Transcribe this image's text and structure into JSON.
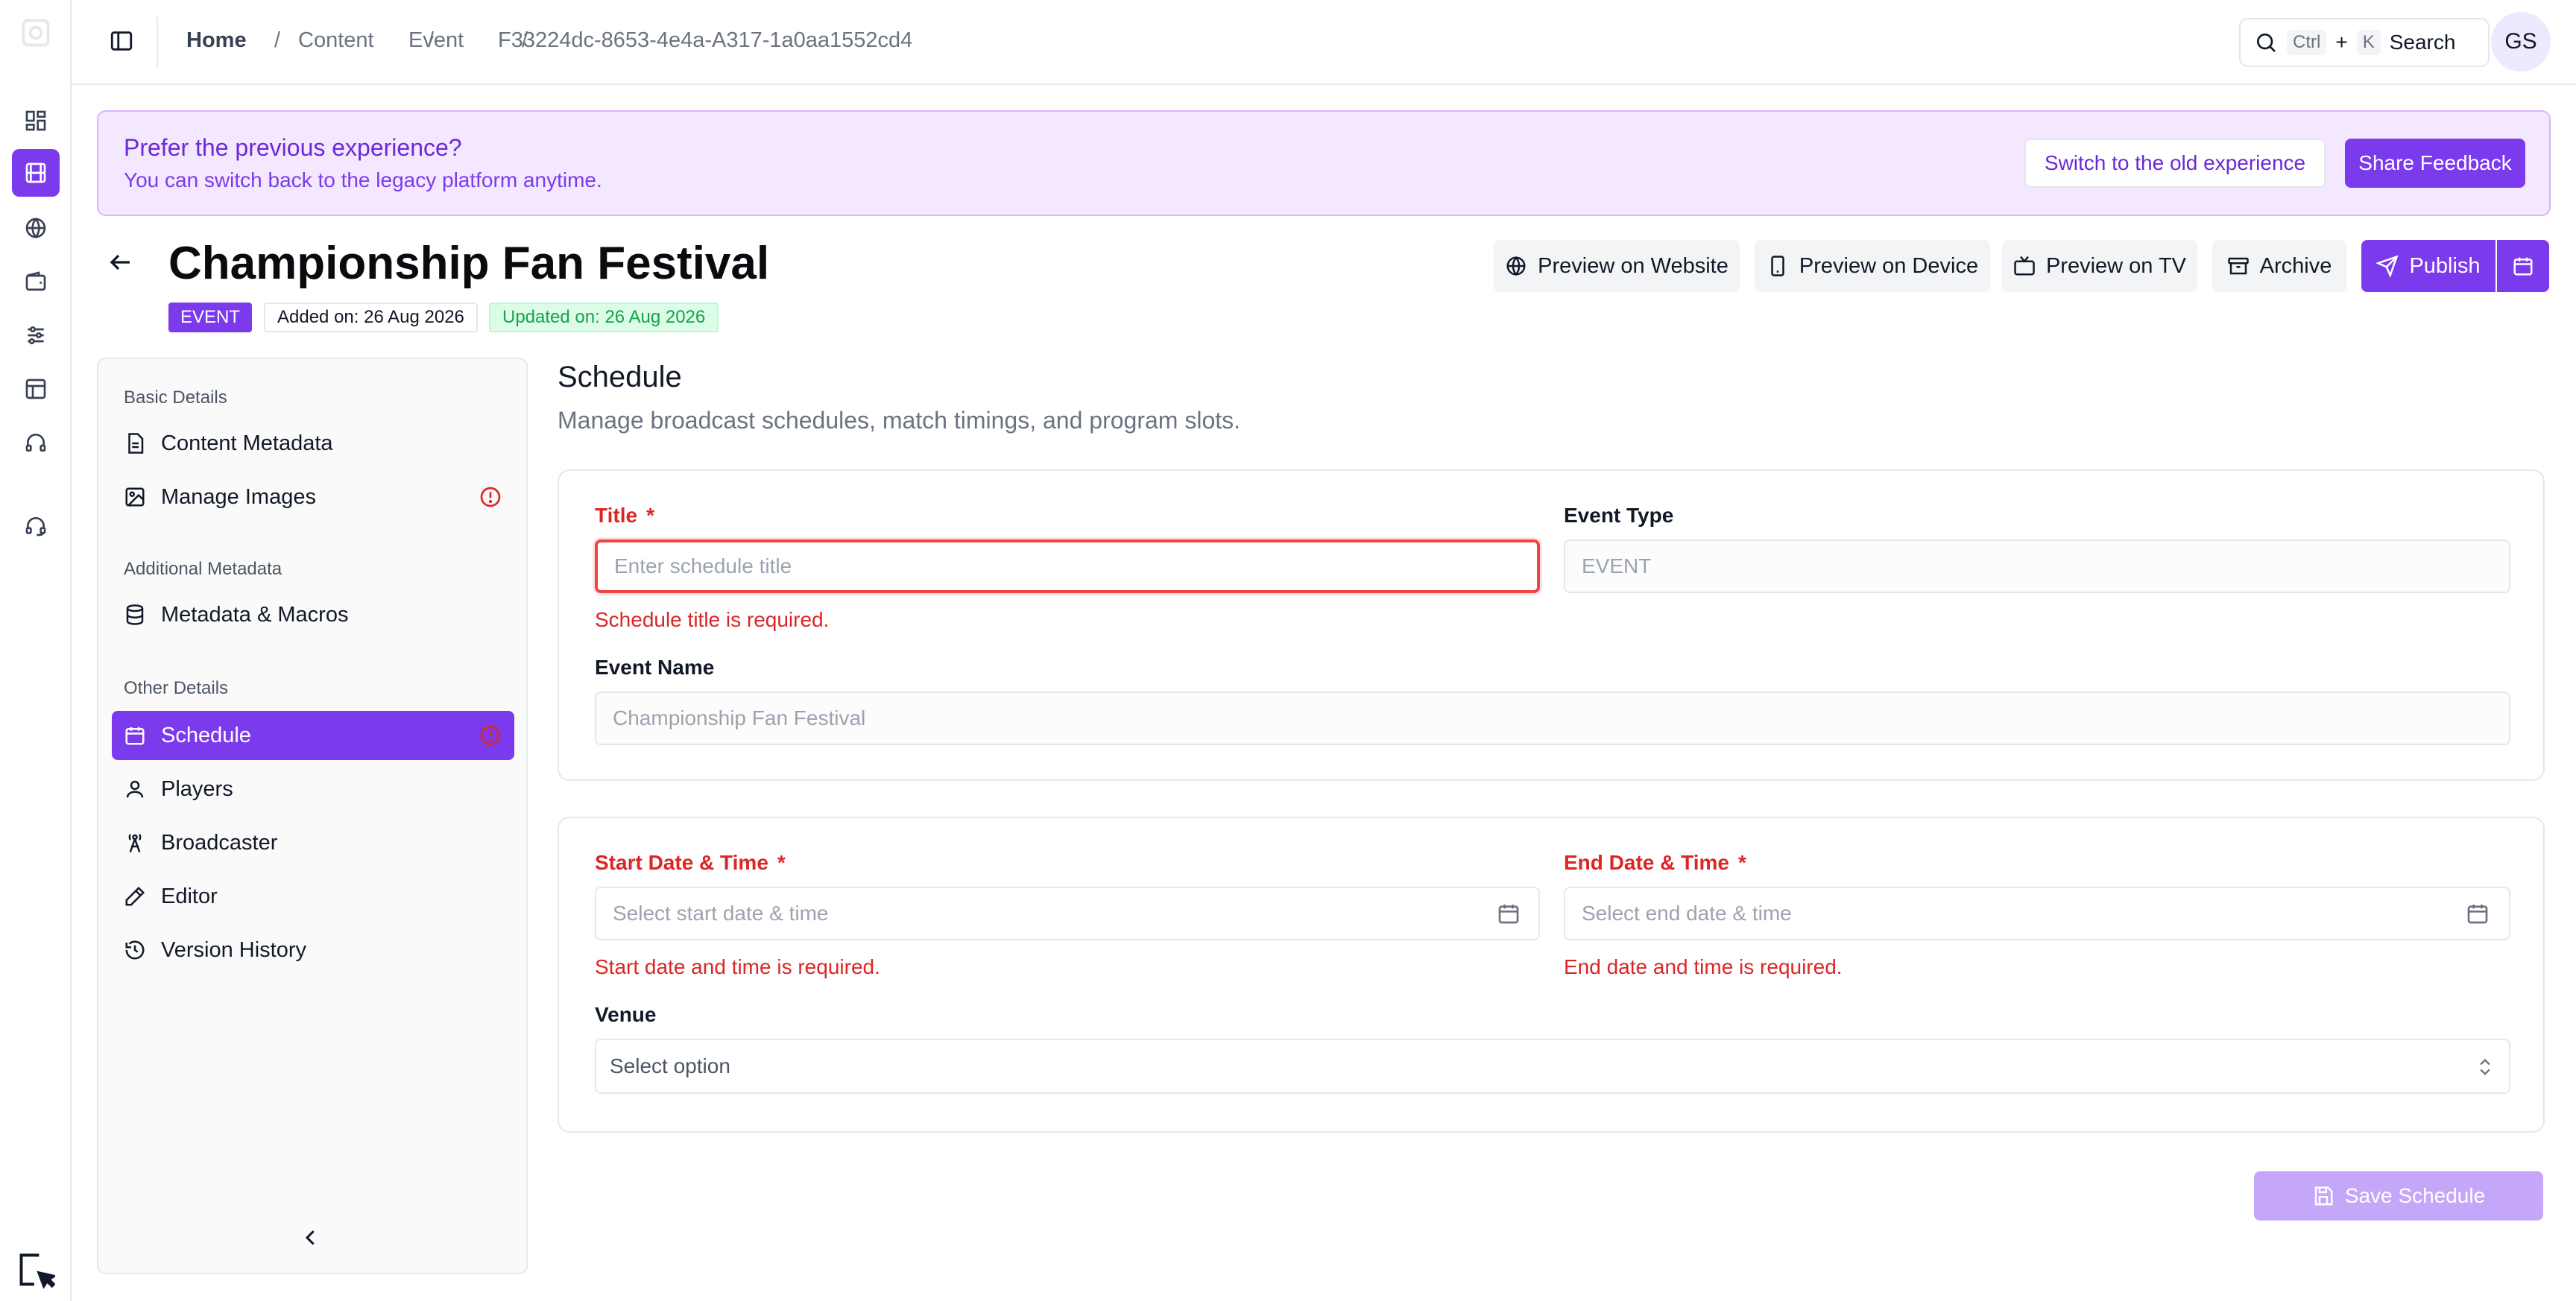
{
  "breadcrumb": {
    "home": "Home",
    "items": [
      "Content",
      "Event",
      "F33224dc-8653-4e4a-A317-1a0aa1552cd4"
    ],
    "separator": "/"
  },
  "search": {
    "kbd_ctrl": "Ctrl",
    "kbd_plus": "+",
    "kbd_k": "K",
    "label": "Search"
  },
  "user": {
    "initials": "GS"
  },
  "banner": {
    "title": "Prefer the previous experience?",
    "subtitle": "You can switch back to the legacy platform anytime.",
    "switch_label": "Switch to the old experience",
    "feedback_label": "Share Feedback"
  },
  "header": {
    "title": "Championship Fan Festival",
    "type_badge": "EVENT",
    "added": "Added on: 26 Aug 2026",
    "updated": "Updated on: 26 Aug 2026",
    "actions": {
      "preview_website": "Preview on Website",
      "preview_device": "Preview on Device",
      "preview_tv": "Preview on TV",
      "archive": "Archive",
      "publish": "Publish"
    }
  },
  "sidebar": {
    "groups": [
      {
        "heading": "Basic Details",
        "items": [
          "Content Metadata",
          "Manage Images"
        ]
      },
      {
        "heading": "Additional Metadata",
        "items": [
          "Metadata & Macros"
        ]
      },
      {
        "heading": "Other Details",
        "items": [
          "Schedule",
          "Players",
          "Broadcaster",
          "Editor",
          "Version History"
        ]
      }
    ],
    "active_item": "Schedule"
  },
  "schedule": {
    "title": "Schedule",
    "subtitle": "Manage broadcast schedules, match timings, and program slots.",
    "title_label": "Title",
    "title_placeholder": "Enter schedule title",
    "title_error": "Schedule title is required.",
    "event_type_label": "Event Type",
    "event_type_value": "EVENT",
    "event_name_label": "Event Name",
    "event_name_value": "Championship Fan Festival",
    "start_label": "Start Date & Time",
    "start_placeholder": "Select start date & time",
    "start_error": "Start date and time is required.",
    "end_label": "End Date & Time",
    "end_placeholder": "Select end date & time",
    "end_error": "End date and time is required.",
    "venue_label": "Venue",
    "venue_placeholder": "Select option",
    "required_mark": "*",
    "save_label": "Save Schedule"
  },
  "colors": {
    "accent": "#7c3aed",
    "error": "#dc2626",
    "banner_bg": "#f3e8ff",
    "success_bg": "#dcfce7"
  }
}
